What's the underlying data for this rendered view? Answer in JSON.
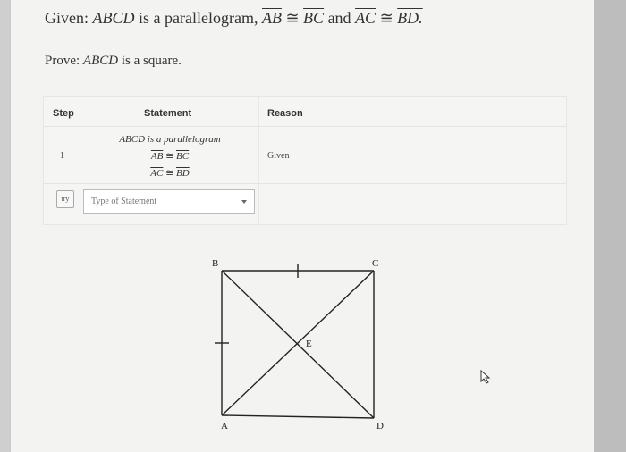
{
  "problem": {
    "given_prefix": "Given:",
    "given_shape": "ABCD",
    "given_middle": "is a parallelogram,",
    "seg_ab": "AB",
    "seg_bc": "BC",
    "and_word": "and",
    "seg_ac": "AC",
    "seg_bd": "BD.",
    "congruent_symbol": "≅",
    "prove_prefix": "Prove:",
    "prove_shape": "ABCD",
    "prove_suffix": "is a square."
  },
  "table": {
    "headers": {
      "step": "Step",
      "statement": "Statement",
      "reason": "Reason"
    },
    "rows": [
      {
        "step": "1",
        "statement_line1": "ABCD is a parallelogram",
        "statement_line2_left": "AB",
        "statement_line2_right": "BC",
        "statement_line3_left": "AC",
        "statement_line3_right": "BD",
        "reason": "Given"
      }
    ],
    "try_label": "try",
    "statement_select_placeholder": "Type of Statement"
  },
  "diagram": {
    "points": {
      "a": "A",
      "b": "B",
      "c": "C",
      "d": "D",
      "e": "E"
    }
  }
}
